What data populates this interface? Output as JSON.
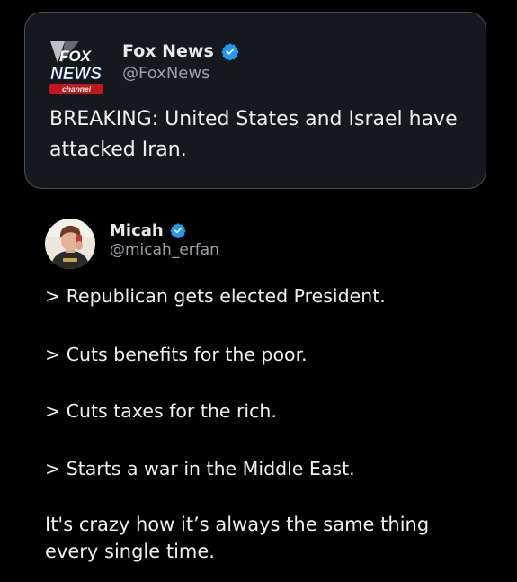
{
  "quoted_post": {
    "logo_text_top": "FOX",
    "logo_text_mid": "NEWS",
    "logo_text_bottom": "channel",
    "name": "Fox News",
    "handle": "@FoxNews",
    "text": "BREAKING: United States and Israel have attacked Iran.",
    "verified_icon": "verified-badge-icon"
  },
  "post": {
    "name": "Micah",
    "handle": "@micah_erfan",
    "verified_icon": "verified-badge-icon",
    "lines": [
      "> Republican gets elected President.",
      "> Cuts benefits for the poor.",
      "> Cuts taxes for the rich.",
      "> Starts a war in the Middle East."
    ],
    "closing": "It's crazy how it’s always the same thing every single time."
  },
  "colors": {
    "background": "#000000",
    "card_background": "#15181c",
    "card_border": "#4a4f55",
    "verified_blue": "#1d9bf0",
    "text_primary": "#e7e9ea",
    "text_secondary": "#9aa0a6"
  }
}
